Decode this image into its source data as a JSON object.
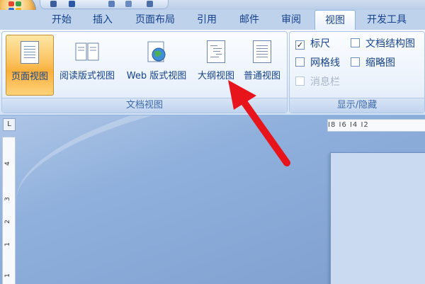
{
  "tabs": [
    "开始",
    "插入",
    "页面布局",
    "引用",
    "邮件",
    "审阅",
    "视图",
    "开发工具"
  ],
  "active_tab": "视图",
  "doc_views_group": {
    "label": "文档视图",
    "buttons": [
      {
        "label": "页面视图",
        "active": true
      },
      {
        "label": "阅读版式视图"
      },
      {
        "label": "Web 版式视图"
      },
      {
        "label": "大纲视图"
      },
      {
        "label": "普通视图"
      }
    ]
  },
  "show_hide_group": {
    "label": "显示/隐藏",
    "checkboxes": [
      {
        "label": "标尺",
        "checked": true
      },
      {
        "label": "文档结构图",
        "checked": false
      },
      {
        "label": "网格线",
        "checked": false
      },
      {
        "label": "缩略图",
        "checked": false
      },
      {
        "label": "消息栏",
        "checked": false,
        "disabled": true
      }
    ]
  },
  "ruler_corner": "L",
  "hruler_text": "I8  I6  I4  I2",
  "vruler_ticks": [
    "4",
    "3",
    "2",
    "1",
    "1"
  ],
  "colors": {
    "accent_tab": "#15428b",
    "arrow": "#e8141c",
    "active_button": "#fbc25e"
  }
}
